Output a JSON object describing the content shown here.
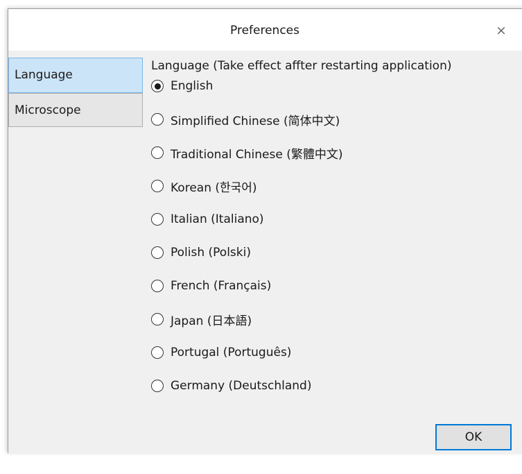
{
  "window": {
    "title": "Preferences",
    "close_glyph": "×"
  },
  "sidebar": {
    "items": [
      {
        "label": "Language",
        "selected": true
      },
      {
        "label": "Microscope",
        "selected": false
      }
    ]
  },
  "language_panel": {
    "group_label": "Language (Take effect affter restarting application)",
    "selected_value": "English",
    "options": [
      {
        "label": "English",
        "checked": true
      },
      {
        "label": "Simplified Chinese (简体中文)",
        "checked": false
      },
      {
        "label": "Traditional Chinese (繁體中文)",
        "checked": false
      },
      {
        "label": "Korean (한국어)",
        "checked": false
      },
      {
        "label": "Italian (Italiano)",
        "checked": false
      },
      {
        "label": "Polish (Polski)",
        "checked": false
      },
      {
        "label": "French (Français)",
        "checked": false
      },
      {
        "label": "Japan (日本語)",
        "checked": false
      },
      {
        "label": "Portugal (Português)",
        "checked": false
      },
      {
        "label": "Germany (Deutschland)",
        "checked": false
      }
    ]
  },
  "footer": {
    "ok_label": "OK"
  },
  "colors": {
    "selected_tab_bg": "#cce4f7",
    "selected_tab_border": "#7ab6e8",
    "default_button_border": "#0078d7",
    "dialog_bg": "#f0f0f0"
  }
}
